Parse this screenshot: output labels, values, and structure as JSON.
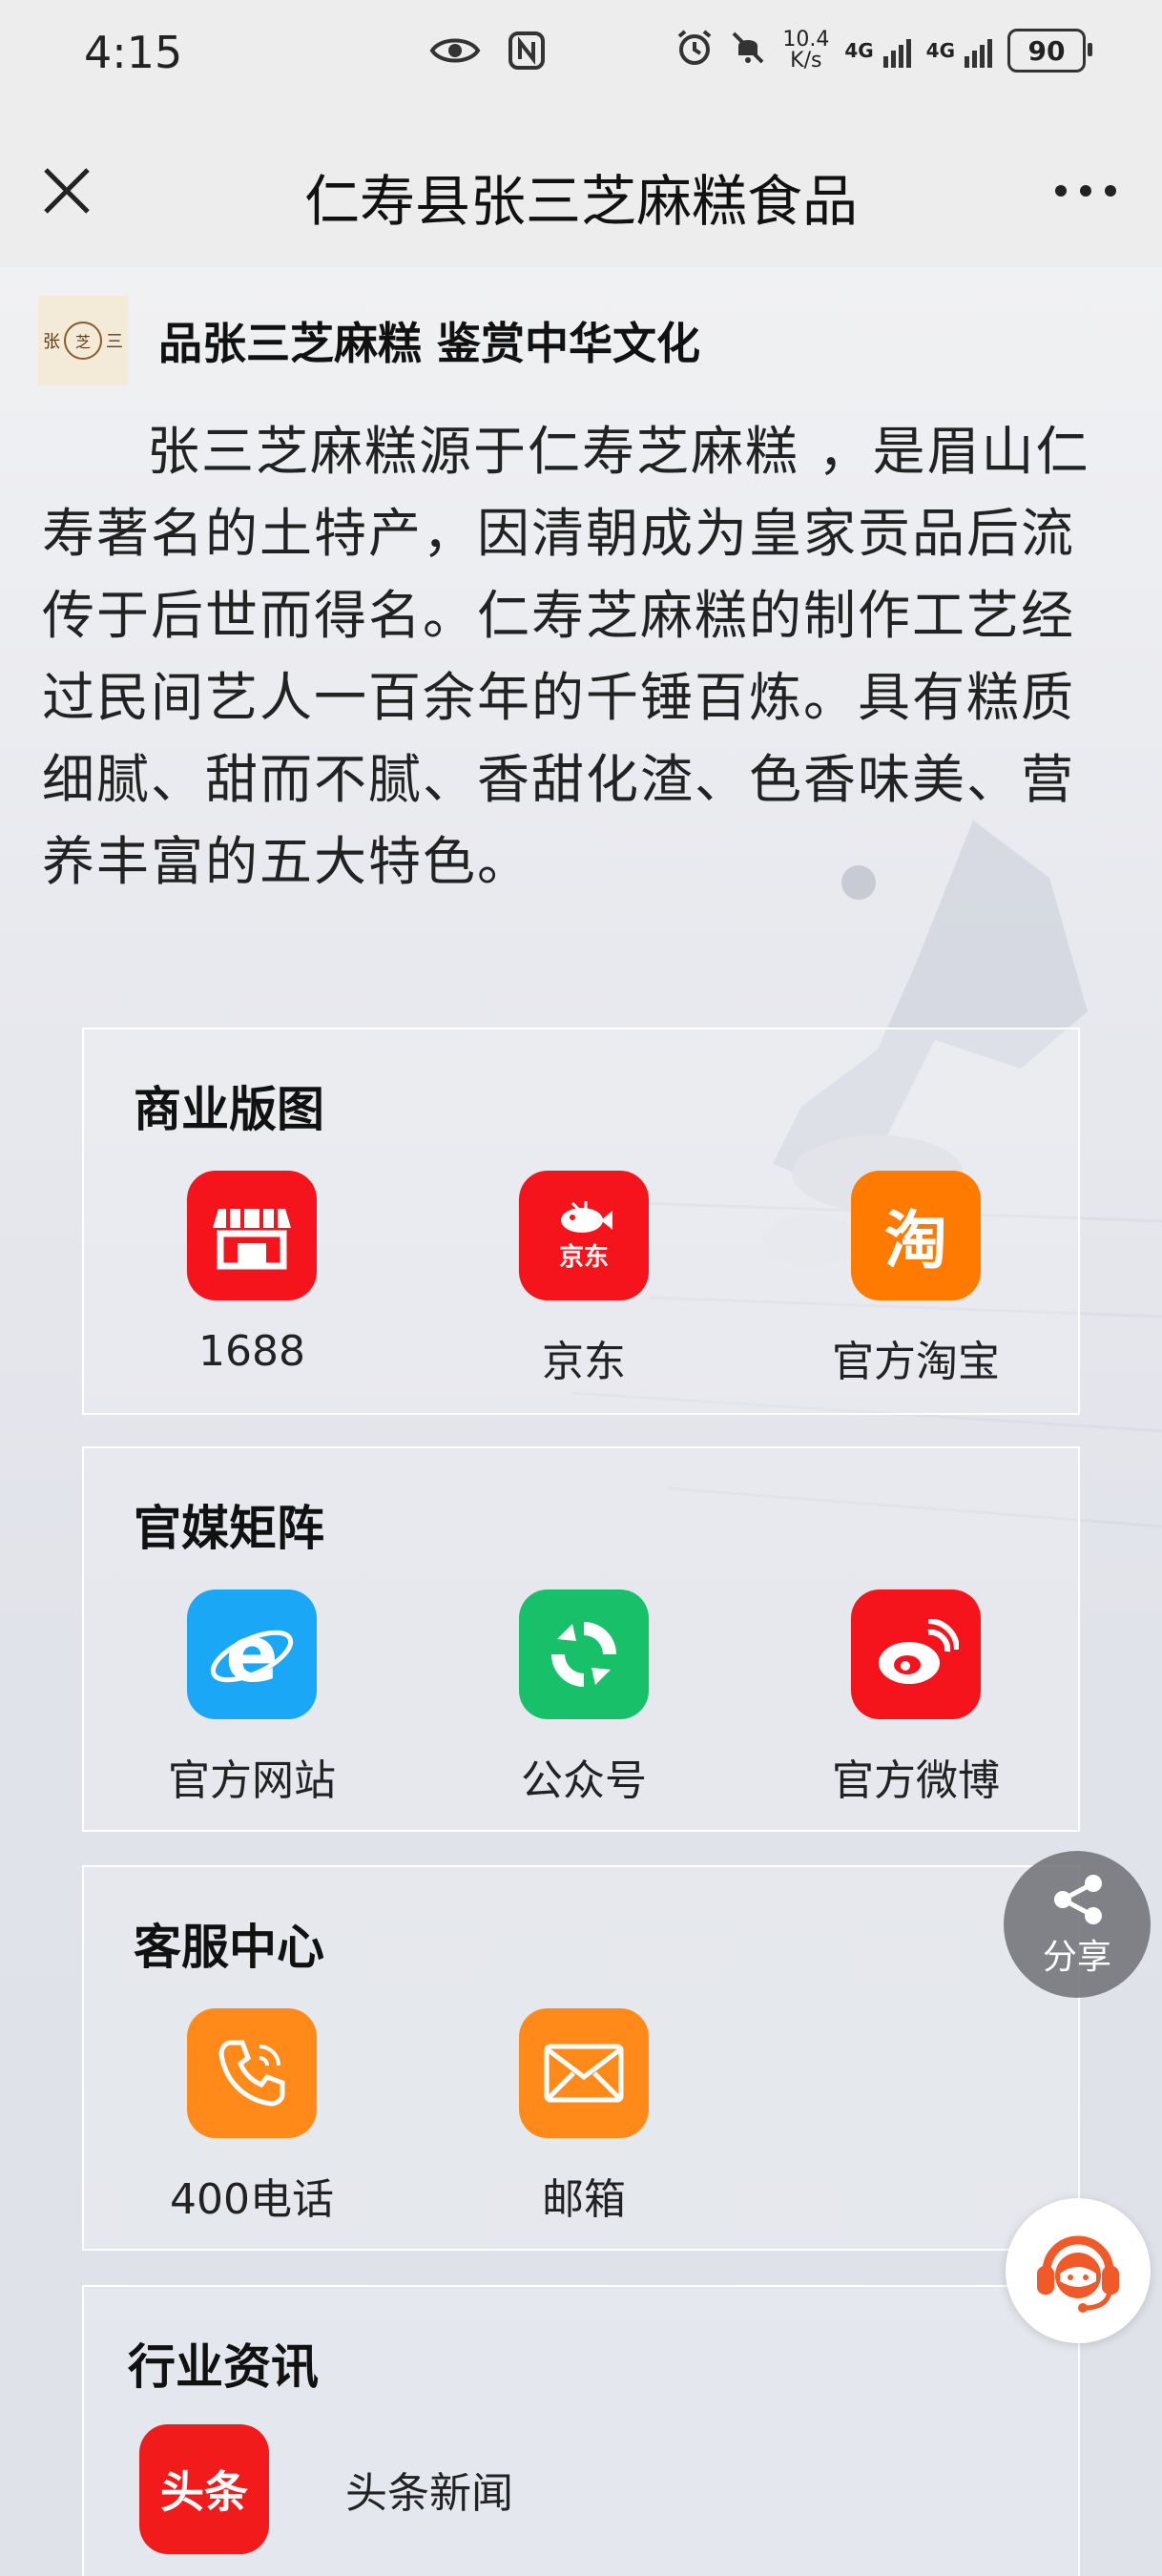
{
  "status_bar": {
    "time": "4:15",
    "net_speed_value": "10.4",
    "net_speed_unit": "K/s",
    "net_type_1": "4G",
    "net_type_2": "4G",
    "battery": "90"
  },
  "title_bar": {
    "title": "仁寿县张三芝麻糕食品"
  },
  "brand": {
    "logo_left": "张",
    "logo_mid": "芝",
    "logo_right": "三",
    "slogan": "品张三芝麻糕 鉴赏中华文化"
  },
  "intro": "张三芝麻糕源于仁寿芝麻糕 ，是眉山仁寿著名的土特产，因清朝成为皇家贡品后流传于后世而得名。仁寿芝麻糕的制作工艺经过民间艺人一百余年的千锤百炼。具有糕质细腻、甜而不腻、香甜化渣、色香味美、营养丰富的五大特色。",
  "sections": {
    "commerce": {
      "title": "商业版图",
      "items": [
        {
          "label": "1688",
          "icon": "store-icon",
          "color": "#f5141c"
        },
        {
          "label": "京东",
          "icon": "jd-icon",
          "icon_text": "京东",
          "color": "#f5141c"
        },
        {
          "label": "官方淘宝",
          "icon": "taobao-icon",
          "icon_text": "淘",
          "color": "#ff7a00"
        }
      ]
    },
    "media": {
      "title": "官媒矩阵",
      "items": [
        {
          "label": "官方网站",
          "icon": "browser-icon",
          "color": "#1aa7f5"
        },
        {
          "label": "公众号",
          "icon": "wechat-official-icon",
          "color": "#18c06a"
        },
        {
          "label": "官方微博",
          "icon": "weibo-icon",
          "color": "#f5141c"
        }
      ]
    },
    "service": {
      "title": "客服中心",
      "items": [
        {
          "label": "400电话",
          "icon": "phone-icon",
          "color": "#ff8a1a"
        },
        {
          "label": "邮箱",
          "icon": "mail-icon",
          "color": "#ff8a1a"
        }
      ]
    },
    "news": {
      "title": "行业资讯",
      "items": [
        {
          "label": "头条新闻",
          "icon": "toutiao-icon",
          "icon_text": "头条",
          "color": "#f21b1b"
        }
      ]
    }
  },
  "floating": {
    "share_label": "分享",
    "customer_service_icon": "headset-agent-icon"
  }
}
